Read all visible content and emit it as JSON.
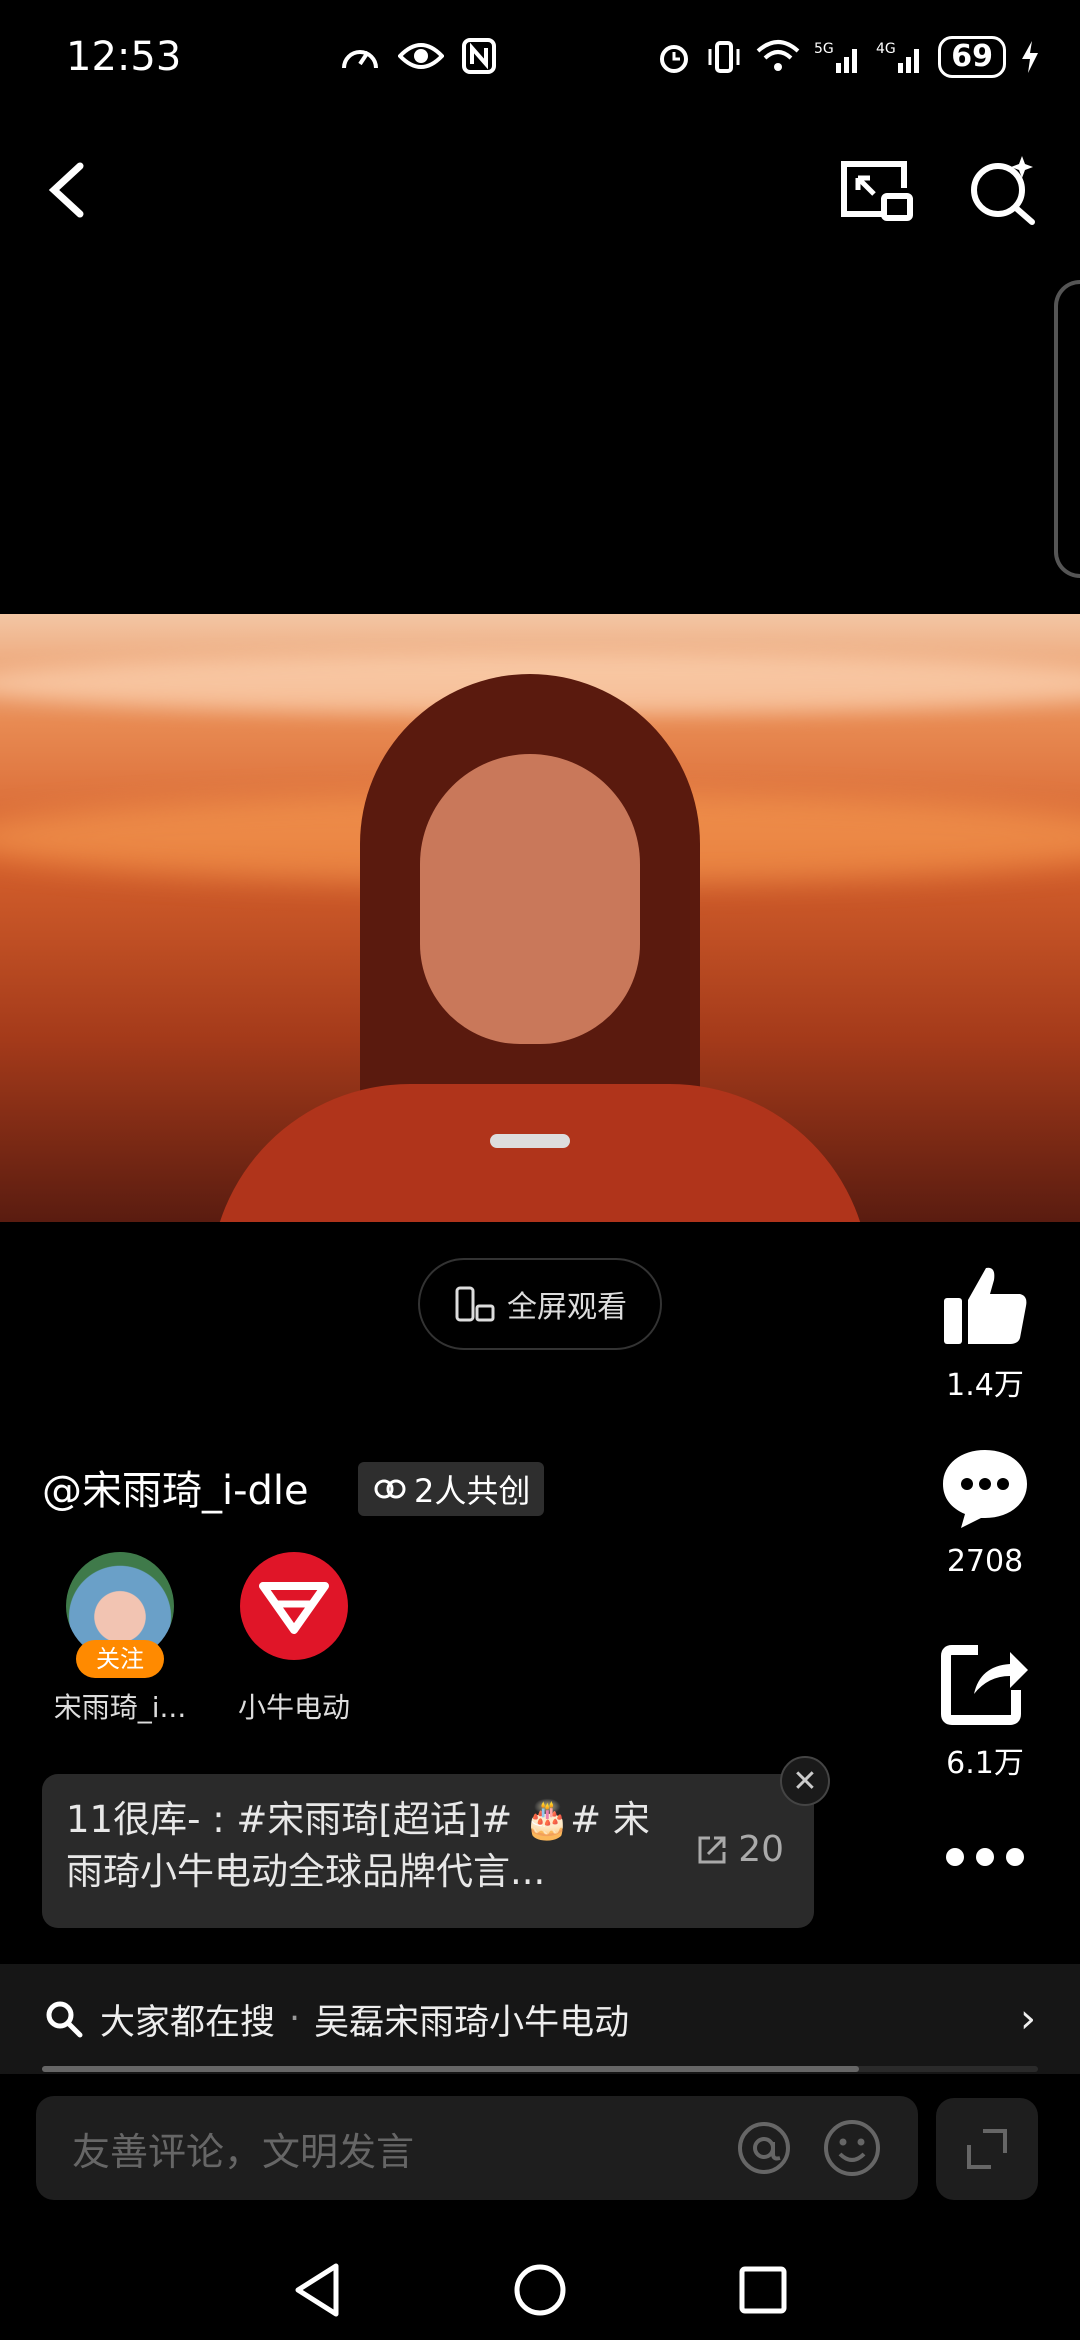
{
  "status": {
    "time": "12:53",
    "battery": "69",
    "left_icons": [
      "speedometer-icon",
      "eye-icon",
      "nfc-icon"
    ],
    "right_icons": [
      "alarm-icon",
      "vibrate-icon",
      "wifi-icon",
      "5g-signal-icon",
      "4g-signal-icon",
      "charging-icon"
    ]
  },
  "header": {
    "back_icon": "chevron-left-icon",
    "pip_icon": "picture-in-picture-icon",
    "search_icon": "search-sparkle-icon"
  },
  "video": {
    "fullscreen_label": "全屏观看"
  },
  "actions": {
    "like_count": "1.4万",
    "comment_count": "2708",
    "share_count": "6.1万"
  },
  "author": {
    "handle": "@宋雨琦_i-dle",
    "cocreate_label": "2人共创"
  },
  "creators": [
    {
      "name": "宋雨琦_i...",
      "follow_label": "关注"
    },
    {
      "name": "小牛电动"
    }
  ],
  "topic": {
    "text": "11很库- : #宋雨琦[超话]# 🎂# 宋雨琦小牛电动全球品牌代言...",
    "count": "20"
  },
  "search_strip": {
    "prefix": "大家都在搜",
    "separator": "·",
    "query": "吴磊宋雨琦小牛电动",
    "progress": 0.82
  },
  "comment_bar": {
    "placeholder": "友善评论，文明发言"
  },
  "colors": {
    "accent_orange": "#ff8a00",
    "brand_red": "#e01528",
    "background": "#000000"
  }
}
